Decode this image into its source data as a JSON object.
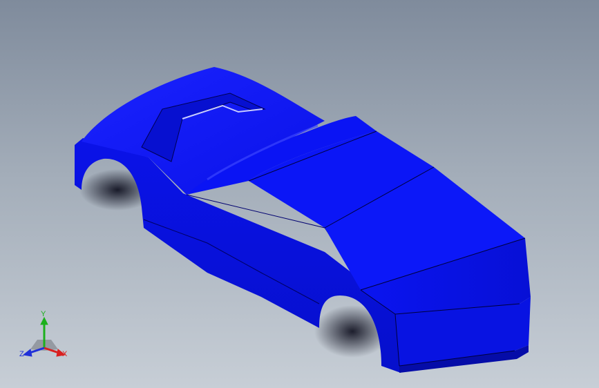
{
  "viewport": {
    "background_top": "#7f8b9c",
    "background_bottom": "#c7ced6"
  },
  "model": {
    "object": "car-body",
    "body_color": "#0a12e8",
    "shade_color": "#0409b8",
    "highlight_color": "#2b33ff"
  },
  "triad": {
    "x_label": "X",
    "y_label": "Y",
    "z_label": "Z",
    "x_color": "#d92020",
    "y_color": "#1cb01c",
    "z_color": "#2030d8"
  }
}
